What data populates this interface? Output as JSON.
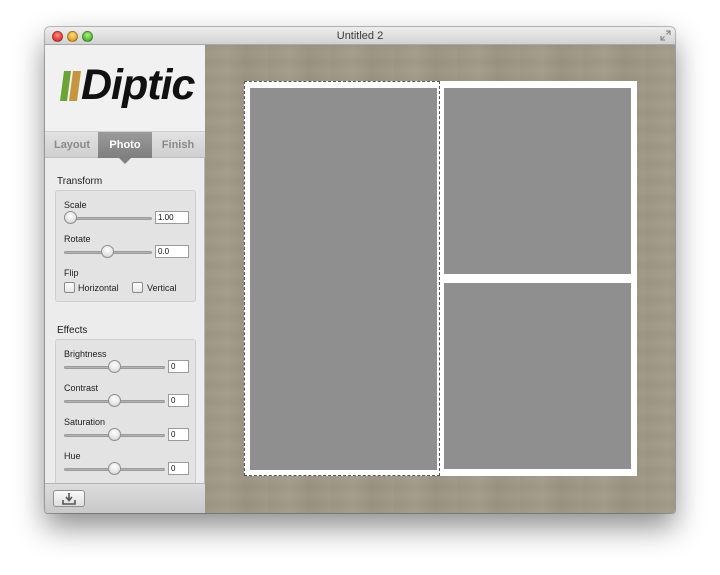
{
  "window": {
    "title": "Untitled 2"
  },
  "logo": {
    "text": "Diptic"
  },
  "tabs": [
    {
      "label": "Layout"
    },
    {
      "label": "Photo"
    },
    {
      "label": "Finish"
    }
  ],
  "active_tab": "Photo",
  "transform": {
    "title": "Transform",
    "scale": {
      "label": "Scale",
      "value": "1.00",
      "level": 0.0
    },
    "rotate": {
      "label": "Rotate",
      "value": "0.0",
      "level": 0.5
    },
    "flip": {
      "label": "Flip",
      "horizontal": "Horizontal",
      "vertical": "Vertical",
      "horizontal_checked": false,
      "vertical_checked": false
    }
  },
  "effects": {
    "title": "Effects",
    "brightness": {
      "label": "Brightness",
      "value": "0",
      "level": 0.5
    },
    "contrast": {
      "label": "Contrast",
      "value": "0",
      "level": 0.5
    },
    "saturation": {
      "label": "Saturation",
      "value": "0",
      "level": 0.5
    },
    "hue": {
      "label": "Hue",
      "value": "0",
      "level": 0.5
    }
  },
  "colors": {
    "canvas_background": "#a09988",
    "photo_placeholder": "#8f8f8f",
    "frame_border": "#ffffff",
    "active_tab": "#8a8a8a"
  },
  "icons": {
    "export": "download-tray-icon"
  }
}
